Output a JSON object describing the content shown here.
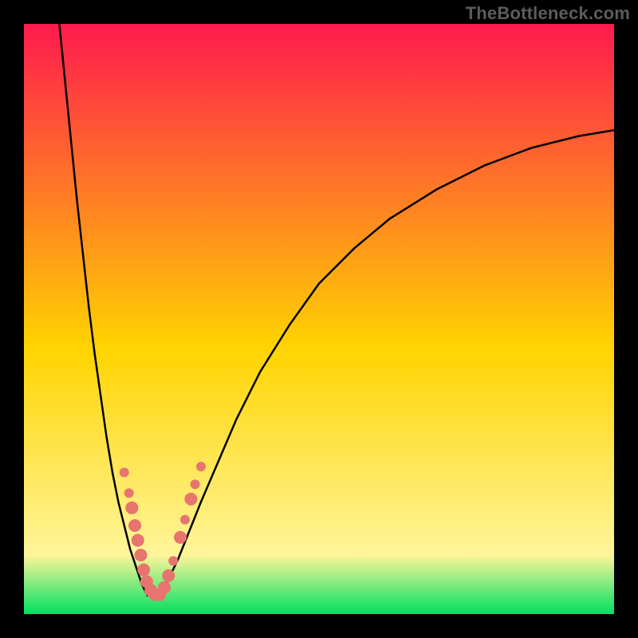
{
  "watermark": "TheBottleneck.com",
  "chart_data": {
    "type": "line",
    "title": "",
    "xlabel": "",
    "ylabel": "",
    "xlim": [
      0,
      100
    ],
    "ylim": [
      0,
      100
    ],
    "grid": false,
    "legend": false,
    "background_gradient": {
      "top": "#ff1a4e",
      "mid": "#ffd400",
      "low": "#fff59a",
      "base": "#00e060"
    },
    "series": [
      {
        "name": "left-branch",
        "x": [
          6,
          7,
          8,
          9,
          10,
          11,
          12,
          13,
          14,
          15,
          16,
          17,
          18,
          19,
          20,
          21
        ],
        "y": [
          100,
          90,
          80,
          70,
          61,
          52,
          44,
          37,
          30,
          24,
          19,
          15,
          11,
          8,
          5,
          3
        ]
      },
      {
        "name": "right-branch",
        "x": [
          23,
          24,
          26,
          28,
          30,
          33,
          36,
          40,
          45,
          50,
          56,
          62,
          70,
          78,
          86,
          94,
          100
        ],
        "y": [
          3,
          5,
          9,
          14,
          19,
          26,
          33,
          41,
          49,
          56,
          62,
          67,
          72,
          76,
          79,
          81,
          82
        ]
      }
    ],
    "scatter_points": {
      "name": "bottleneck-markers",
      "color": "#e8746f",
      "points": [
        {
          "x": 17.0,
          "y": 24.0,
          "r": 6
        },
        {
          "x": 17.8,
          "y": 20.5,
          "r": 6
        },
        {
          "x": 18.3,
          "y": 18.0,
          "r": 8
        },
        {
          "x": 18.8,
          "y": 15.0,
          "r": 8
        },
        {
          "x": 19.3,
          "y": 12.5,
          "r": 8
        },
        {
          "x": 19.8,
          "y": 10.0,
          "r": 8
        },
        {
          "x": 20.3,
          "y": 7.5,
          "r": 8
        },
        {
          "x": 20.8,
          "y": 5.5,
          "r": 8
        },
        {
          "x": 21.5,
          "y": 4.0,
          "r": 8
        },
        {
          "x": 22.2,
          "y": 3.3,
          "r": 8
        },
        {
          "x": 23.0,
          "y": 3.3,
          "r": 8
        },
        {
          "x": 23.8,
          "y": 4.5,
          "r": 8
        },
        {
          "x": 24.5,
          "y": 6.5,
          "r": 8
        },
        {
          "x": 25.3,
          "y": 9.0,
          "r": 6
        },
        {
          "x": 26.5,
          "y": 13.0,
          "r": 8
        },
        {
          "x": 27.3,
          "y": 16.0,
          "r": 6
        },
        {
          "x": 28.3,
          "y": 19.5,
          "r": 8
        },
        {
          "x": 29.0,
          "y": 22.0,
          "r": 6
        },
        {
          "x": 30.0,
          "y": 25.0,
          "r": 6
        }
      ]
    }
  }
}
